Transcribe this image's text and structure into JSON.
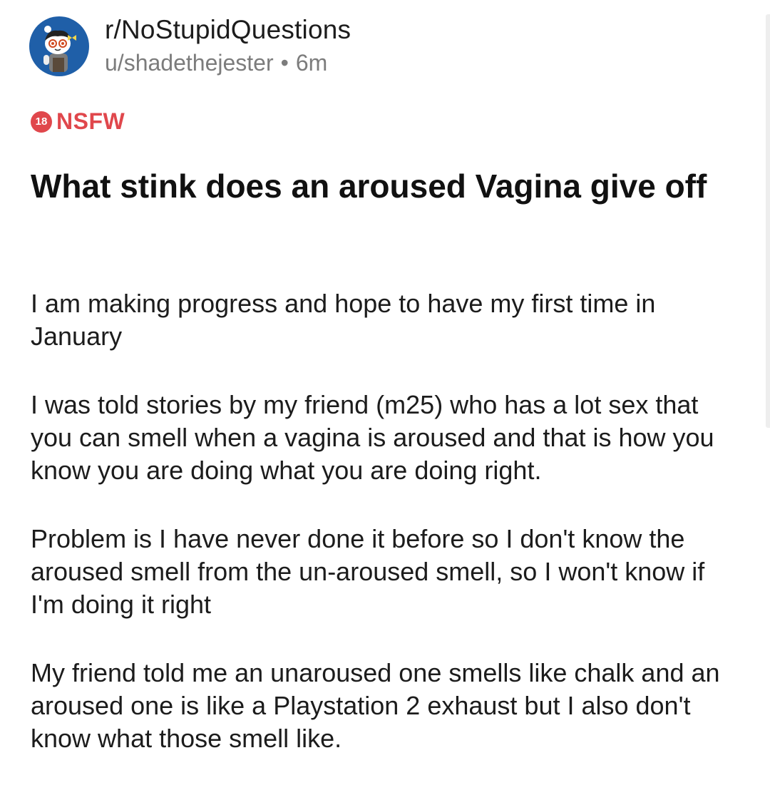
{
  "post": {
    "subreddit": "r/NoStupidQuestions",
    "author": "u/shadethejester",
    "separator": "•",
    "age": "6m",
    "nsfw_badge": "18",
    "nsfw_label": "NSFW",
    "title": "What stink does an aroused Vagina give off",
    "paragraphs": [
      "I am making progress and hope to have my first time in January",
      "I was told stories by my friend (m25) who has a lot sex that you can smell when a vagina is aroused and that is how you know you are doing what you are doing right.",
      "Problem is I have never done it before so I don't know the aroused smell from the un-aroused smell, so I won't know if I'm doing it right",
      "My friend told me an unaroused one smells like chalk and an aroused one is like a Playstation 2 exhaust but I also don't know what those smell like."
    ]
  },
  "icons": {
    "avatar": "snoo-avatar-icon"
  },
  "colors": {
    "nsfw": "#e0474c",
    "avatar_bg": "#1f5fa8",
    "meta_text": "#7c7c7c"
  }
}
